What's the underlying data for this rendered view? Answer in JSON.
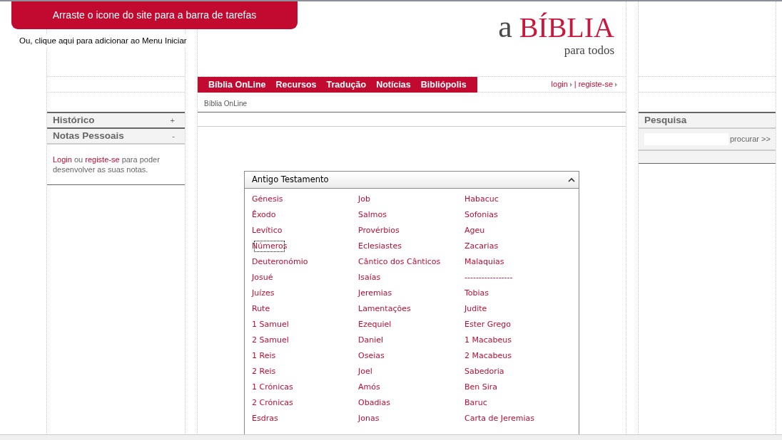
{
  "banner": {
    "title": "Arraste o icone do site para a barra de tarefas",
    "link": "Ou, clique aqui para adicionar ao Menu Iniciar"
  },
  "logo": {
    "article": "a",
    "name": "BÍBLIA",
    "tagline": "para todos"
  },
  "nav": {
    "items": [
      {
        "label": "Bíblia OnLine"
      },
      {
        "label": "Recursos"
      },
      {
        "label": "Tradução"
      },
      {
        "label": "Notícias"
      },
      {
        "label": "Bibliópolis"
      }
    ],
    "account": [
      {
        "label": "login"
      },
      {
        "label": "registe-se"
      }
    ],
    "separator": "|"
  },
  "breadcrumb": "Bíblia OnLine",
  "sidebar": {
    "sections": [
      {
        "title": "Histórico",
        "toggle": "+"
      },
      {
        "title": "Notas Pessoais",
        "toggle": "-",
        "body": [
          {
            "kind": "link",
            "text": "Login"
          },
          {
            "kind": "text",
            "text": " ou "
          },
          {
            "kind": "link",
            "text": "registe-se"
          },
          {
            "kind": "text",
            "text": " para poder desenvolver as suas notas."
          }
        ]
      }
    ]
  },
  "search": {
    "title": "Pesquisa",
    "button": "procurar >>"
  },
  "books": {
    "title": "Antigo Testamento",
    "expanded": true,
    "columns": [
      [
        {
          "label": "Génesis",
          "focused": false
        },
        {
          "label": "Êxodo",
          "focused": false
        },
        {
          "label": "Levítico",
          "focused": false
        },
        {
          "label": "Números",
          "focused": true
        },
        {
          "label": "Deuteronómio",
          "focused": false
        },
        {
          "label": "Josué",
          "focused": false
        },
        {
          "label": "Juízes",
          "focused": false
        },
        {
          "label": "Rute",
          "focused": false
        },
        {
          "label": "1 Samuel",
          "focused": false
        },
        {
          "label": "2 Samuel",
          "focused": false
        },
        {
          "label": "1 Reis",
          "focused": false
        },
        {
          "label": "2 Reis",
          "focused": false
        },
        {
          "label": "1 Crónicas",
          "focused": false
        },
        {
          "label": "2 Crónicas",
          "focused": false
        },
        {
          "label": "Esdras",
          "focused": false
        }
      ],
      [
        {
          "label": "Job",
          "focused": false
        },
        {
          "label": "Salmos",
          "focused": false
        },
        {
          "label": "Provérbios",
          "focused": false
        },
        {
          "label": "Eclesiastes",
          "focused": false
        },
        {
          "label": "Cântico dos Cânticos",
          "focused": false
        },
        {
          "label": "Isaías",
          "focused": false
        },
        {
          "label": "Jeremias",
          "focused": false
        },
        {
          "label": "Lamentações",
          "focused": false
        },
        {
          "label": "Ezequiel",
          "focused": false
        },
        {
          "label": "Daniel",
          "focused": false
        },
        {
          "label": "Oseias",
          "focused": false
        },
        {
          "label": "Joel",
          "focused": false
        },
        {
          "label": "Amós",
          "focused": false
        },
        {
          "label": "Obadias",
          "focused": false
        },
        {
          "label": "Jonas",
          "focused": false
        }
      ],
      [
        {
          "label": "Habacuc",
          "focused": false
        },
        {
          "label": "Sofonias",
          "focused": false
        },
        {
          "label": "Ageu",
          "focused": false
        },
        {
          "label": "Zacarias",
          "focused": false
        },
        {
          "label": "Malaquias",
          "focused": false
        },
        {
          "label": "-----------------",
          "focused": false
        },
        {
          "label": "Tobias",
          "focused": false
        },
        {
          "label": "Judite",
          "focused": false
        },
        {
          "label": "Ester Grego",
          "focused": false
        },
        {
          "label": "1 Macabeus",
          "focused": false
        },
        {
          "label": "2 Macabeus",
          "focused": false
        },
        {
          "label": "Sabedoria",
          "focused": false
        },
        {
          "label": "Ben Sira",
          "focused": false
        },
        {
          "label": "Baruc",
          "focused": false
        },
        {
          "label": "Carta de Jeremias",
          "focused": false
        }
      ]
    ]
  }
}
